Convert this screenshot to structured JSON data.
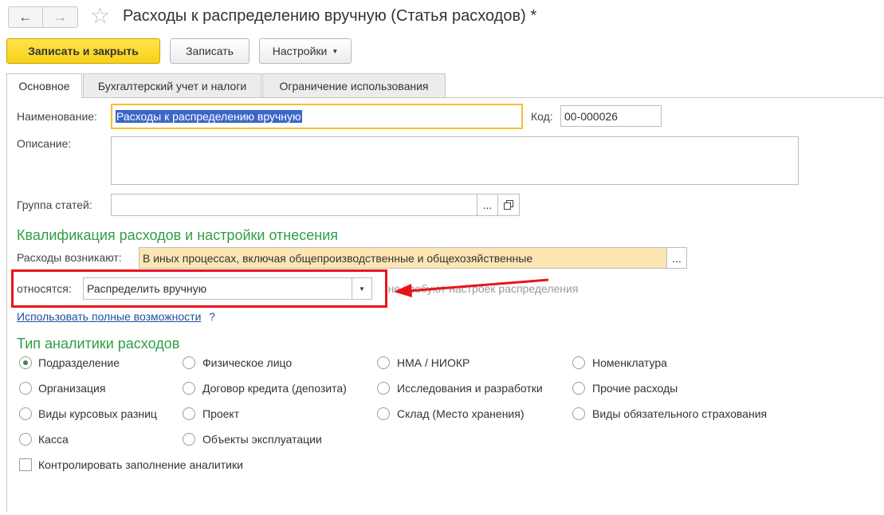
{
  "window": {
    "title": "Расходы к распределению вручную (Статья расходов) *"
  },
  "toolbar": {
    "save_close_label": "Записать и закрыть",
    "save_label": "Записать",
    "settings_label": "Настройки"
  },
  "tabs": [
    {
      "label": "Основное",
      "active": true
    },
    {
      "label": "Бухгалтерский учет и налоги",
      "active": false
    },
    {
      "label": "Ограничение использования",
      "active": false
    }
  ],
  "form": {
    "name_label": "Наименование:",
    "name_value": "Расходы к распределению вручную",
    "code_label": "Код:",
    "code_value": "00-000026",
    "description_label": "Описание:",
    "description_value": "",
    "group_label": "Группа статей:",
    "group_value": "",
    "group_choose_label": "...",
    "section1_title": "Квалификация расходов и настройки отнесения",
    "arise_label": "Расходы возникают:",
    "arise_value": "В иных процессах, включая общепроизводственные и общехозяйственные",
    "arise_choose_label": "...",
    "relate_label": "относятся:",
    "relate_value": "Распределить вручную",
    "relate_hint": "(не требуют настроек распределения",
    "full_features_link": "Использовать полные возможности",
    "help_mark": "?",
    "section2_title": "Тип аналитики расходов",
    "analytics_options": [
      [
        "Подразделение",
        "Организация",
        "Виды курсовых разниц",
        "Касса"
      ],
      [
        "Физическое лицо",
        "Договор кредита (депозита)",
        "Проект",
        "Объекты эксплуатации"
      ],
      [
        "НМА / НИОКР",
        "Исследования и разработки",
        "Склад (Место хранения)"
      ],
      [
        "Номенклатура",
        "Прочие расходы",
        "Виды обязательного страхования"
      ]
    ],
    "analytics_selected": "Подразделение",
    "control_checkbox_label": "Контролировать заполнение аналитики",
    "control_checkbox_checked": false
  },
  "colors": {
    "primary_button": "#f7d117",
    "section_title": "#2f9e44",
    "link": "#1f4f9e",
    "highlight_box": "#e8141b",
    "arrow": "#e8141b",
    "arise_field_bg": "#fde6b4",
    "focus_border": "#f0c030"
  },
  "icons": {
    "back": "arrow-left-icon",
    "forward": "arrow-right-icon",
    "favorite": "star-icon",
    "dropdown": "chevron-down-icon",
    "open": "open-window-icon"
  }
}
